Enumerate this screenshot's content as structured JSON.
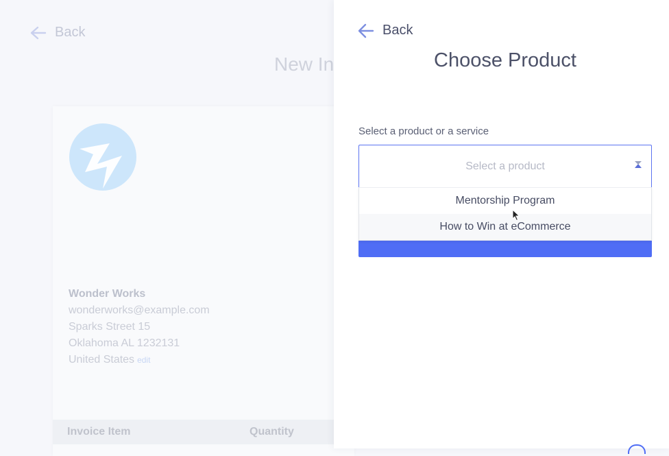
{
  "background": {
    "back_label": "Back",
    "page_title": "New In",
    "address": {
      "company": "Wonder Works",
      "email": "wonderworks@example.com",
      "street": "Sparks Street 15",
      "city": "Oklahoma AL 1232131",
      "country": "United States",
      "edit_label": "edit"
    },
    "table_headers": [
      "Invoice Item",
      "Quantity"
    ]
  },
  "panel": {
    "back_label": "Back",
    "title": "Choose Product",
    "field_label": "Select a product or a service",
    "select_placeholder": "Select a product",
    "options": [
      "Mentorship Program",
      "How to Win at eCommerce"
    ],
    "hovered_option": "How to Win at eCommerce"
  },
  "colors": {
    "accent": "#4f6df5",
    "logo": "#cde6fb"
  }
}
